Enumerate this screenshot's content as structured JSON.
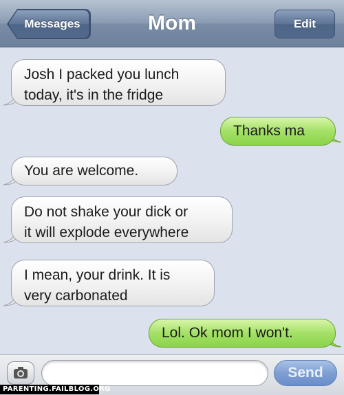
{
  "nav": {
    "back_label": "Messages",
    "title": "Mom",
    "edit_label": "Edit"
  },
  "messages": [
    {
      "direction": "in",
      "lines": [
        "Josh I packed you lunch",
        "today, it's in the fridge"
      ]
    },
    {
      "direction": "out",
      "lines": [
        "Thanks ma"
      ]
    },
    {
      "direction": "in",
      "lines": [
        "You are welcome."
      ]
    },
    {
      "direction": "in",
      "lines": [
        "Do not shake your dick or",
        "it will explode everywhere"
      ]
    },
    {
      "direction": "in",
      "lines": [
        "I mean, your drink. It is",
        "very carbonated"
      ]
    },
    {
      "direction": "out",
      "lines": [
        "Lol. Ok mom I won't."
      ]
    }
  ],
  "composer": {
    "camera_icon": "camera-icon",
    "input_value": "",
    "send_label": "Send"
  },
  "watermark": "PARENTING.FAILBLOG.ORG",
  "colors": {
    "background": "#dbe2ed",
    "incoming_bubble": "#eeeeee",
    "outgoing_bubble": "#a4e067",
    "send_button": "#7f9fd1"
  }
}
